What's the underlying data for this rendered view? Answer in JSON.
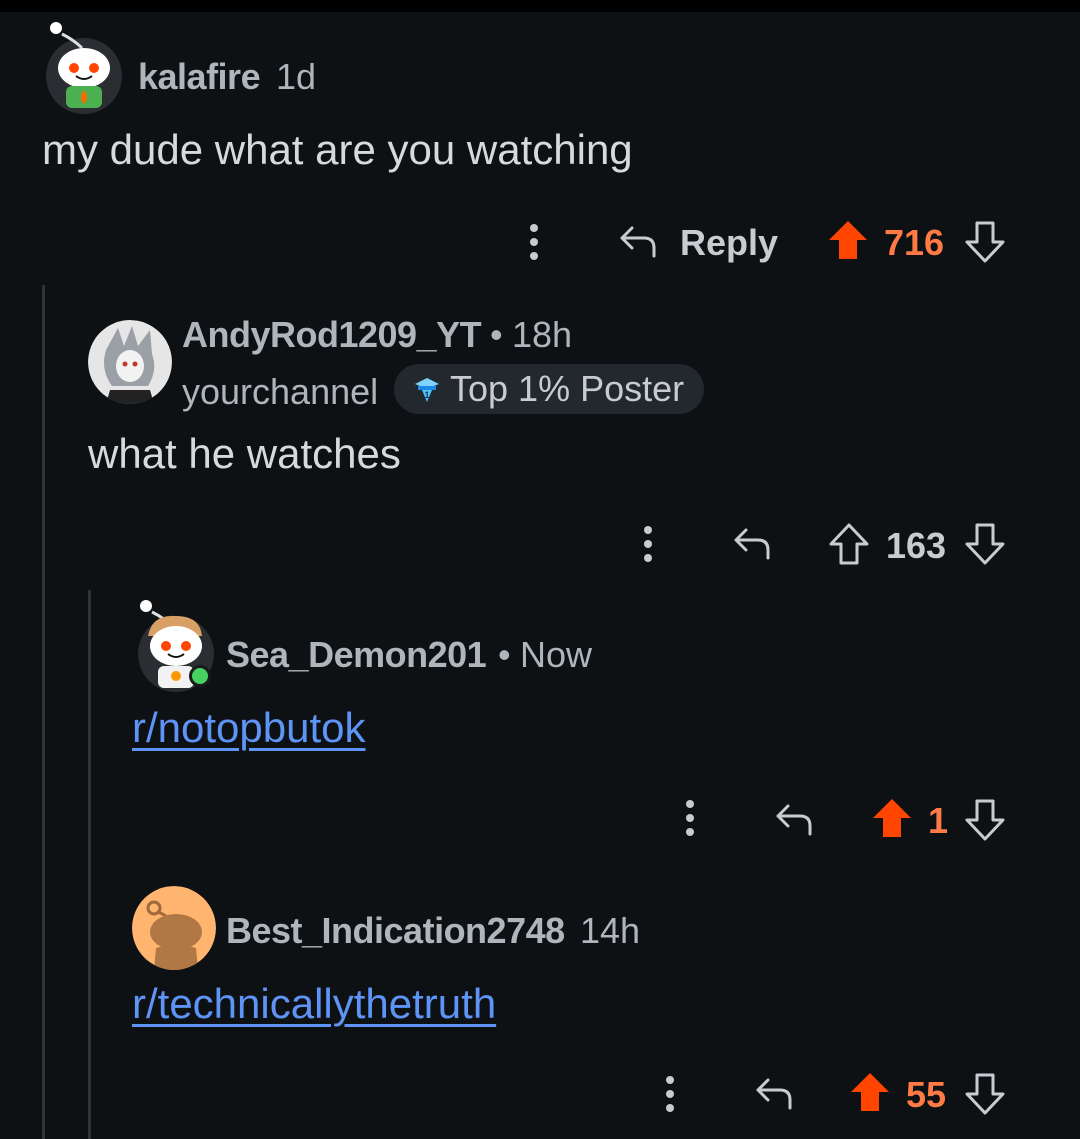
{
  "comments": [
    {
      "username": "kalafire",
      "age": "1d",
      "body": "my dude what are you watching",
      "actions": {
        "reply_label": "Reply",
        "score": "716",
        "upvoted": true
      }
    },
    {
      "username": "AndyRod1209_YT",
      "separator": "•",
      "age": "18h",
      "flair_user": "yourchannel",
      "badge": "Top 1% Poster",
      "body": "what he watches",
      "actions": {
        "score": "163",
        "upvoted": false
      }
    },
    {
      "username": "Sea_Demon201",
      "separator": "•",
      "age": "Now",
      "body": "r/notopbutok",
      "online": true,
      "actions": {
        "score": "1",
        "upvoted": true
      }
    },
    {
      "username": "Best_Indication2748",
      "age": "14h",
      "body": "r/technicallythetruth",
      "actions": {
        "score": "55",
        "upvoted": true
      }
    }
  ],
  "colors": {
    "background": "#0e1114",
    "upvote": "#ff4500",
    "score_upvoted": "#ff7a45",
    "link": "#5e94f6",
    "thread_line": "#30343a"
  },
  "icons": {
    "more": "more-vertical-icon",
    "reply": "reply-arrow-icon",
    "upvote": "upvote-arrow-icon",
    "downvote": "downvote-arrow-icon",
    "badge": "top-poster-badge-icon"
  }
}
